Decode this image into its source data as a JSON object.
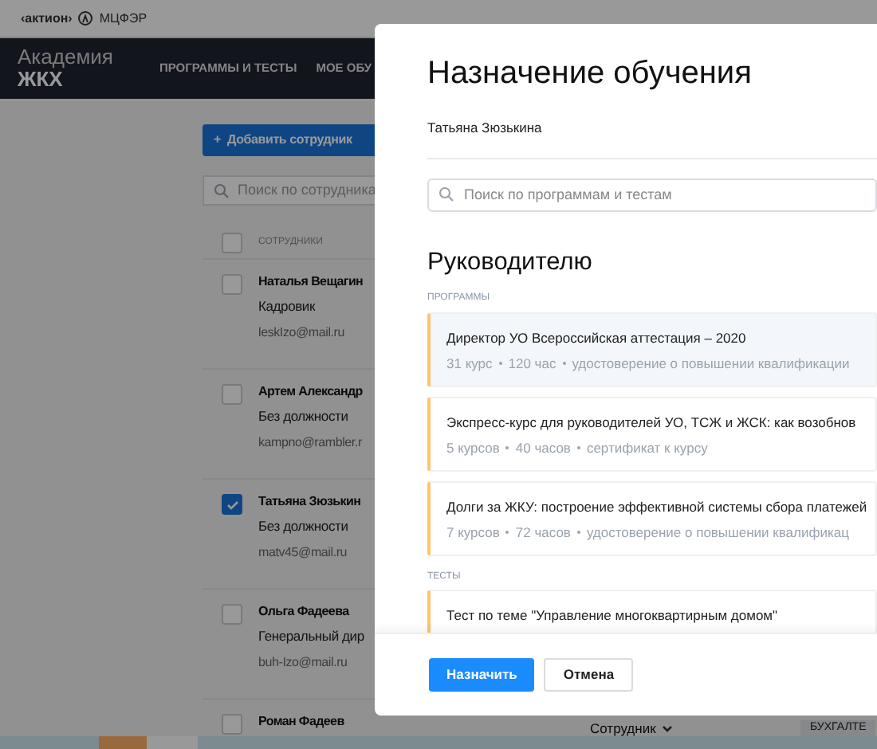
{
  "brand": {
    "name": "‹актион›",
    "product": "МЦФЭР"
  },
  "header": {
    "title": "Академия",
    "subtitle": "ЖКХ",
    "nav": [
      "ПРОГРАММЫ И ТЕСТЫ",
      "МОЕ ОБУ"
    ]
  },
  "add_button": {
    "icon": "+",
    "label": "Добавить сотрудник"
  },
  "search": {
    "placeholder": "Поиск по сотрудника"
  },
  "table": {
    "header": {
      "label": "СОТРУДНИКИ",
      "checked": false
    },
    "rows": [
      {
        "name": "Наталья Вещагин",
        "role": "Кадровик",
        "email": "leskIzo@mail.ru",
        "checked": false
      },
      {
        "name": "Артем Александр",
        "role": "Без должности",
        "email": "kampno@rambler.r",
        "checked": false
      },
      {
        "name": "Татьяна Зюзькин",
        "role": "Без должности",
        "email": "matv45@mail.ru",
        "checked": true
      },
      {
        "name": "Ольга Фадеева",
        "role": "Генеральный дир",
        "email": "buh-Izo@mail.ru",
        "checked": false
      },
      {
        "name": "Роман Фадеев",
        "checked": false
      }
    ]
  },
  "bottom": {
    "role_select": "Сотрудник",
    "tag": "БУХГАЛТЕ"
  },
  "dialog": {
    "title": "Назначение обучения",
    "employee": "Татьяна Зюзькина",
    "search": {
      "placeholder": "Поиск по программам и тестам"
    },
    "section": "Руководителю",
    "groups": [
      {
        "label": "ПРОГРАММЫ",
        "items": [
          {
            "title": "Директор УО Всероссийская аттестация – 2020",
            "meta": [
              "31 курс",
              "120 час",
              "удостоверение о повышении квалификации"
            ],
            "selected": true
          },
          {
            "title": "Экспресс-курс для руководителей УО, ТСЖ и ЖСК: как возобнов",
            "meta": [
              "5 курсов",
              "40 часов",
              "сертификат к курсу"
            ],
            "selected": false
          },
          {
            "title": "Долги за ЖКУ: построение эффективной системы сбора платежей",
            "meta": [
              "7 курсов",
              "72 часов",
              "удостоверение о повышении квалификац"
            ],
            "selected": false
          }
        ]
      },
      {
        "label": "ТЕСТЫ",
        "items": [
          {
            "title": "Тест по теме \"Управление многоквартирным домом\"",
            "selected": false
          }
        ]
      }
    ],
    "buttons": [
      {
        "label": "Назначить",
        "kind": "primary"
      },
      {
        "label": "Отмена",
        "kind": "secondary"
      }
    ]
  }
}
